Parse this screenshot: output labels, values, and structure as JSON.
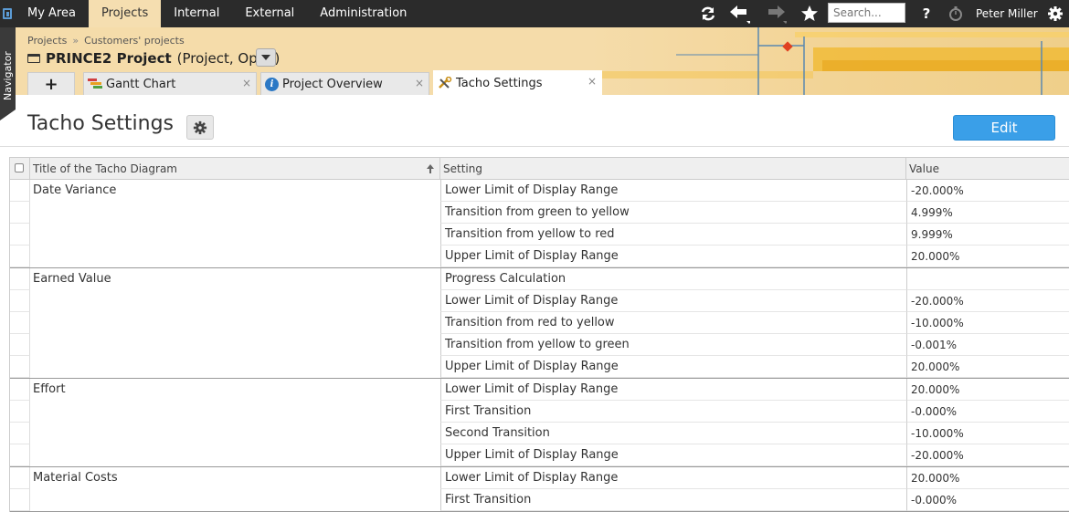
{
  "topnav": [
    {
      "label": "My Area",
      "active": false
    },
    {
      "label": "Projects",
      "active": true
    },
    {
      "label": "Internal",
      "active": false
    },
    {
      "label": "External",
      "active": false
    },
    {
      "label": "Administration",
      "active": false
    }
  ],
  "toolbar": {
    "search_placeholder": "Search...",
    "help_label": "?",
    "user_name": "Peter Miller"
  },
  "navigator_label": "Navigator",
  "breadcrumb": {
    "items": [
      "Projects",
      "Customers' projects"
    ],
    "separator": "»"
  },
  "project": {
    "name": "PRINCE2 Project",
    "meta": "(Project, Open)"
  },
  "tabs": [
    {
      "label": "Gantt Chart",
      "icon": "gantt-icon",
      "close": "×"
    },
    {
      "label": "Project Overview",
      "icon": "info-icon",
      "close": "×"
    },
    {
      "label": "Tacho Settings",
      "icon": "tools-icon",
      "close": "×",
      "active": true
    }
  ],
  "add_tab_label": "+",
  "page": {
    "title": "Tacho Settings",
    "edit_label": "Edit"
  },
  "table": {
    "columns": [
      "Title of the Tacho Diagram",
      "Setting",
      "Value"
    ],
    "groups": [
      {
        "title": "Date Variance",
        "rows": [
          {
            "setting": "Lower Limit of Display Range",
            "value": "-20.000%"
          },
          {
            "setting": "Transition from green to yellow",
            "value": "4.999%"
          },
          {
            "setting": "Transition from yellow to red",
            "value": "9.999%"
          },
          {
            "setting": "Upper Limit of Display Range",
            "value": "20.000%"
          }
        ]
      },
      {
        "title": "Earned Value",
        "rows": [
          {
            "setting": "Progress Calculation",
            "value": ""
          },
          {
            "setting": "Lower Limit of Display Range",
            "value": "-20.000%"
          },
          {
            "setting": "Transition from red to yellow",
            "value": "-10.000%"
          },
          {
            "setting": "Transition from yellow to green",
            "value": "-0.001%"
          },
          {
            "setting": "Upper Limit of Display Range",
            "value": "20.000%"
          }
        ]
      },
      {
        "title": "Effort",
        "rows": [
          {
            "setting": "Lower Limit of Display Range",
            "value": "20.000%"
          },
          {
            "setting": "First Transition",
            "value": "-0.000%"
          },
          {
            "setting": "Second Transition",
            "value": "-10.000%"
          },
          {
            "setting": "Upper Limit of Display Range",
            "value": "-20.000%"
          }
        ]
      },
      {
        "title": "Material Costs",
        "rows": [
          {
            "setting": "Lower Limit of Display Range",
            "value": "20.000%"
          },
          {
            "setting": "First Transition",
            "value": "-0.000%"
          }
        ]
      }
    ]
  },
  "colors": {
    "accent": "#3a9fe8",
    "active_nav": "#f5deb0",
    "topbar": "#2b2b2b"
  }
}
